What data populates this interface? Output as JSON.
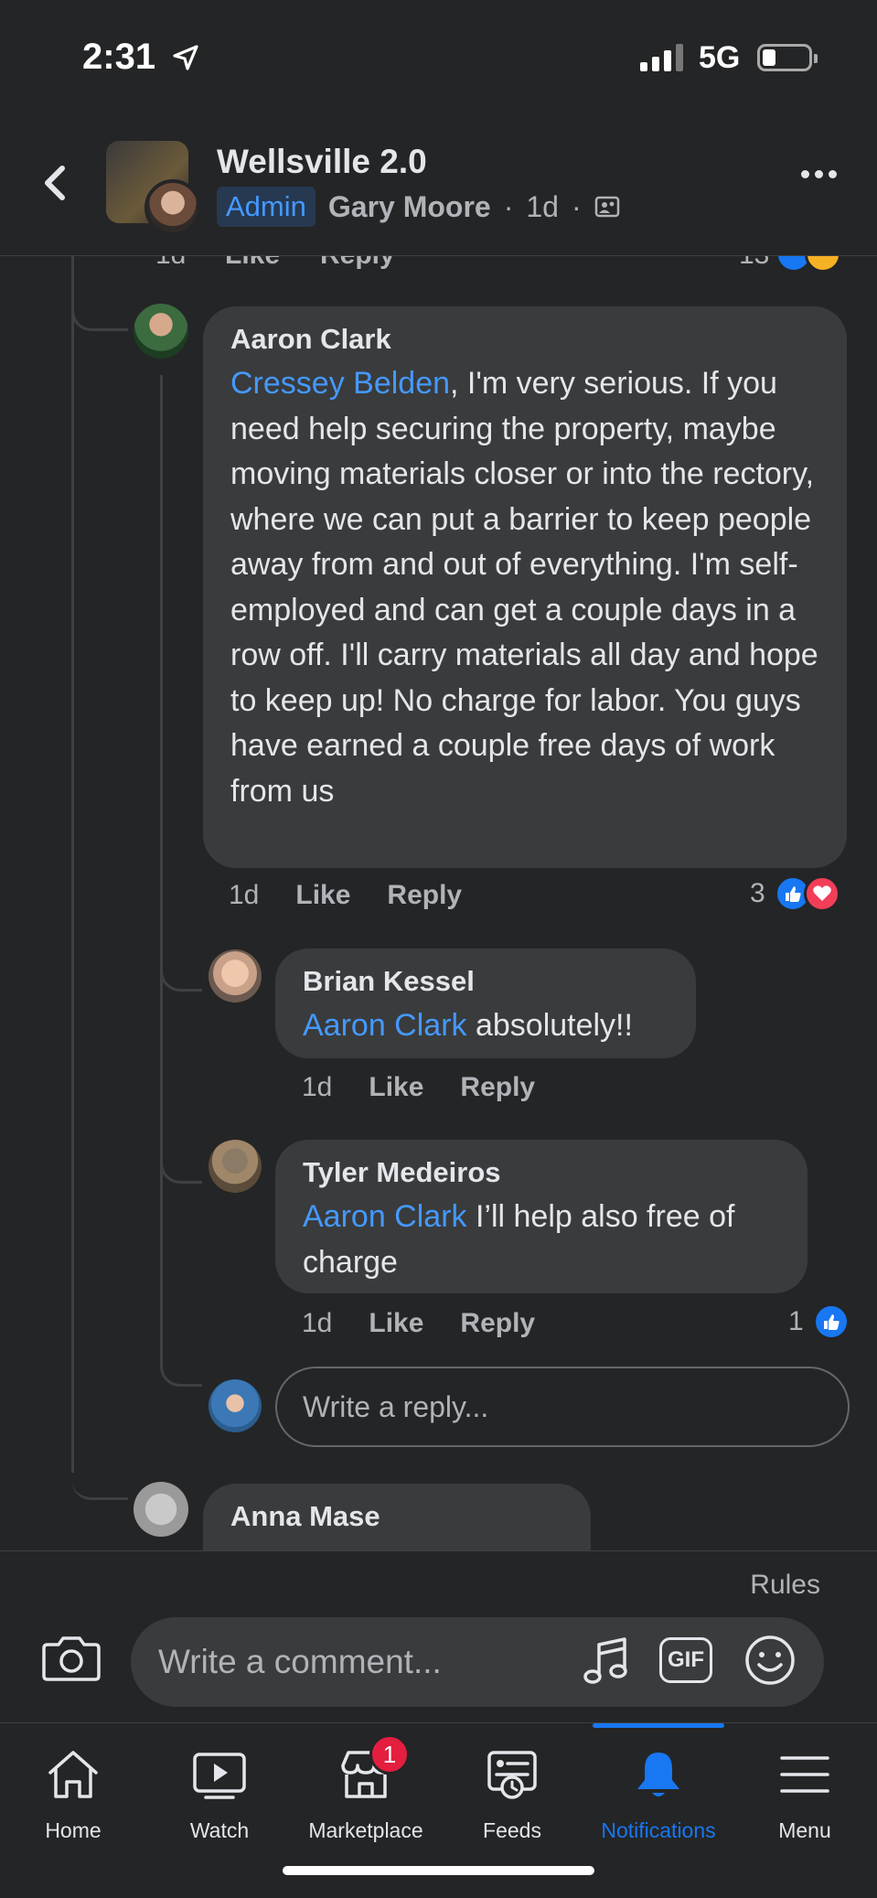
{
  "status_bar": {
    "time": "2:31",
    "network": "5G"
  },
  "header": {
    "group_name": "Wellsville 2.0",
    "role_badge": "Admin",
    "poster": "Gary Moore",
    "age": "1d",
    "separator": "·"
  },
  "prev_comment": {
    "time": "1d",
    "like": "Like",
    "reply": "Reply",
    "reaction_count": "13"
  },
  "comments": [
    {
      "author": "Aaron Clark",
      "mention": "Cressey Belden",
      "text": ", I'm very serious.  If you need help securing the property, maybe moving materials closer or into the rectory, where we can put a barrier to keep people away from and out of everything.  I'm self-employed and can get a couple days in a row off.  I'll carry materials all day and hope to keep up!  No charge for labor.  You guys have earned a couple free days of work from us",
      "time": "1d",
      "like": "Like",
      "reply": "Reply",
      "reaction_count": "3"
    },
    {
      "author": "Brian Kessel",
      "mention": "Aaron Clark",
      "text": " absolutely!!",
      "time": "1d",
      "like": "Like",
      "reply": "Reply"
    },
    {
      "author": "Tyler Medeiros",
      "mention": "Aaron Clark",
      "text": " I’ll help also free of charge",
      "time": "1d",
      "like": "Like",
      "reply": "Reply",
      "reaction_count": "1"
    },
    {
      "author": "Anna Mase"
    }
  ],
  "reply_box": {
    "placeholder": "Write a reply..."
  },
  "composer": {
    "rules": "Rules",
    "placeholder": "Write a comment...",
    "gif": "GIF"
  },
  "tabs": [
    {
      "label": "Home",
      "icon": "home-icon"
    },
    {
      "label": "Watch",
      "icon": "watch-icon"
    },
    {
      "label": "Marketplace",
      "icon": "marketplace-icon",
      "badge": "1"
    },
    {
      "label": "Feeds",
      "icon": "feeds-icon"
    },
    {
      "label": "Notifications",
      "icon": "bell-icon",
      "active": true
    },
    {
      "label": "Menu",
      "icon": "menu-icon"
    }
  ],
  "colors": {
    "accent": "#1877f2",
    "mention": "#4599ff",
    "background": "#242526",
    "bubble": "#3a3b3c"
  }
}
